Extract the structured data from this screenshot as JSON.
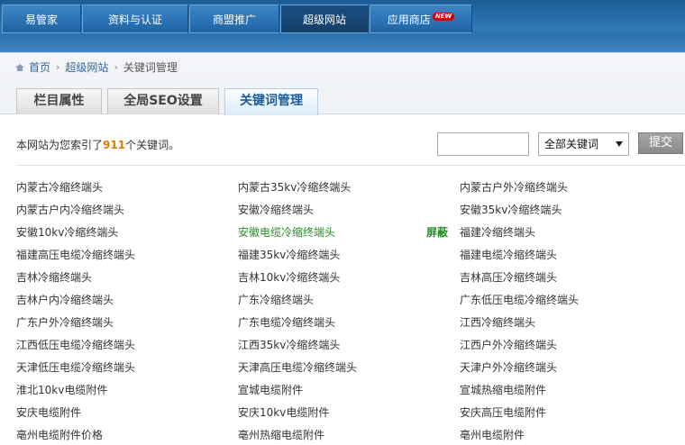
{
  "nav": {
    "items": [
      {
        "label": "易管家"
      },
      {
        "label": "资料与认证"
      },
      {
        "label": "商盟推广"
      },
      {
        "label": "超级网站",
        "active": true
      },
      {
        "label": "应用商店",
        "badge": "NEW"
      }
    ]
  },
  "breadcrumb": {
    "home": "首页",
    "level1": "超级网站",
    "current": "关键词管理",
    "separator": "›"
  },
  "tabs": [
    {
      "label": "栏目属性"
    },
    {
      "label": "全局SEO设置"
    },
    {
      "label": "关键词管理",
      "active": true
    }
  ],
  "summary": {
    "prefix": "本网站为您索引了",
    "count": "911",
    "suffix": "个关键词。"
  },
  "filter": {
    "search_value": "",
    "select_value": "全部关键词",
    "submit_label": "提交"
  },
  "keywords": {
    "shield_label": "屏蔽",
    "rows": [
      [
        "内蒙古冷缩终端头",
        "内蒙古35kv冷缩终端头",
        "内蒙古户外冷缩终端头"
      ],
      [
        "内蒙古户内冷缩终端头",
        "安徽冷缩终端头",
        "安徽35kv冷缩终端头"
      ],
      [
        "安徽10kv冷缩终端头",
        "安徽电缆冷缩终端头",
        "福建冷缩终端头"
      ],
      [
        "福建高压电缆冷缩终端头",
        "福建35kv冷缩终端头",
        "福建电缆冷缩终端头"
      ],
      [
        "吉林冷缩终端头",
        "吉林10kv冷缩终端头",
        "吉林高压冷缩终端头"
      ],
      [
        "吉林户内冷缩终端头",
        "广东冷缩终端头",
        "广东低压电缆冷缩终端头"
      ],
      [
        "广东户外冷缩终端头",
        "广东电缆冷缩终端头",
        "江西冷缩终端头"
      ],
      [
        "江西低压电缆冷缩终端头",
        "江西35kv冷缩终端头",
        "江西户外冷缩终端头"
      ],
      [
        "天津低压电缆冷缩终端头",
        "天津高压电缆冷缩终端头",
        "天津户外冷缩终端头"
      ],
      [
        "淮北10kv电缆附件",
        "宣城电缆附件",
        "宣城热缩电缆附件"
      ],
      [
        "安庆电缆附件",
        "安庆10kv电缆附件",
        "安庆高压电缆附件"
      ],
      [
        "亳州电缆附件价格",
        "亳州热缩电缆附件",
        "亳州电缆附件"
      ]
    ]
  },
  "colors": {
    "nav_bg": "#2f78b6",
    "accent_count": "#e07b00",
    "highlight_green": "#2a8a2a",
    "link_blue": "#356799"
  }
}
